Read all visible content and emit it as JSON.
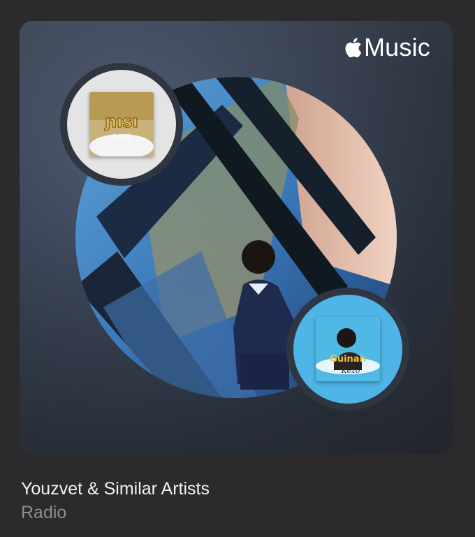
{
  "brand": {
    "text": "Music",
    "icon": "apple-logo-icon"
  },
  "station": {
    "title": "Youzvet & Similar Artists",
    "subtitle": "Radio"
  },
  "colors": {
    "background": "#2b2b2d",
    "card_ring": "#2f3541",
    "mini_2_bg": "#4fb4e6",
    "mini_1_bg": "#e4e4e4"
  }
}
